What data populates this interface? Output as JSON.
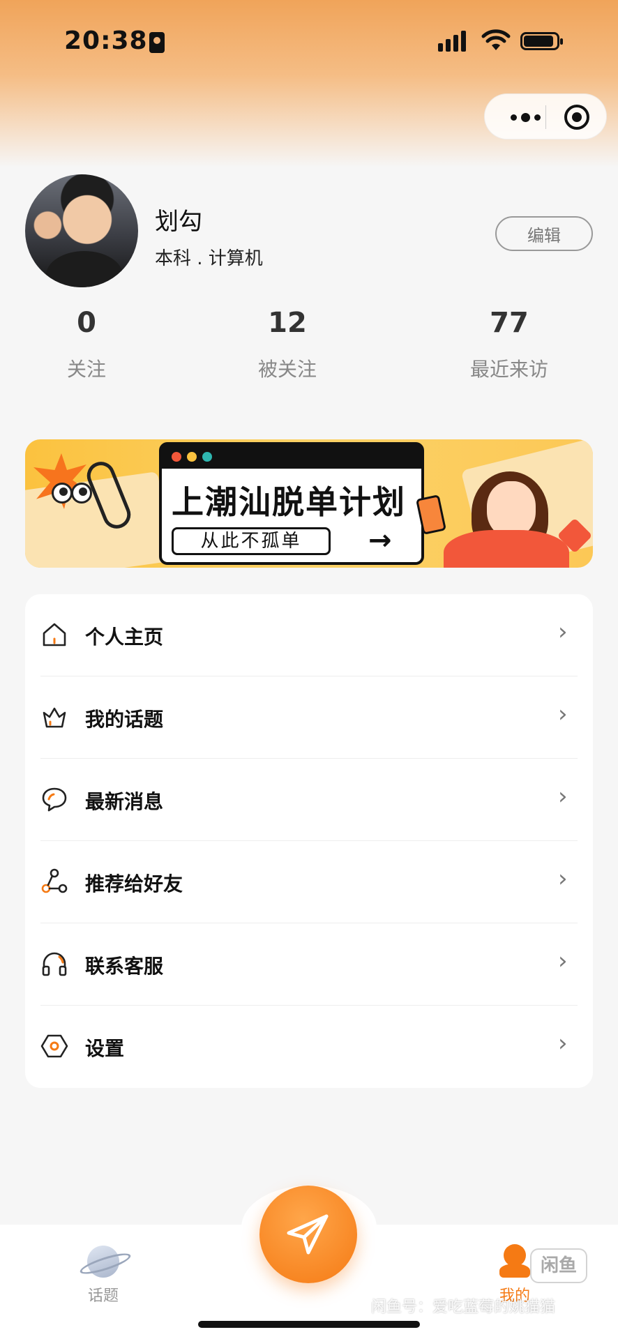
{
  "status_bar": {
    "time": "20:38"
  },
  "profile": {
    "name": "划勾",
    "subtitle": "本科 . 计算机",
    "edit_label": "编辑"
  },
  "stats": [
    {
      "value": "0",
      "label": "关注"
    },
    {
      "value": "12",
      "label": "被关注"
    },
    {
      "value": "77",
      "label": "最近来访"
    }
  ],
  "banner": {
    "title": "上潮汕脱单计划",
    "subtitle": "从此不孤单",
    "arrow": "→"
  },
  "menu": {
    "items": [
      {
        "label": "个人主页",
        "icon": "home-icon"
      },
      {
        "label": "我的话题",
        "icon": "crown-icon"
      },
      {
        "label": "最新消息",
        "icon": "chat-bubble-icon"
      },
      {
        "label": "推荐给好友",
        "icon": "share-icon"
      },
      {
        "label": "联系客服",
        "icon": "headphones-icon"
      },
      {
        "label": "设置",
        "icon": "settings-hexagon-icon"
      }
    ],
    "chevron": "›"
  },
  "tabbar": {
    "tabs": [
      {
        "label": "话题",
        "icon": "planet-icon"
      },
      {
        "label": "我的",
        "icon": "user-icon"
      }
    ]
  },
  "watermark": {
    "text": "闲鱼号：爱吃蓝莓的姚猫猫",
    "badge": "闲鱼"
  },
  "colors": {
    "accent": "#f57a14",
    "banner_bg": "#fbc23f",
    "header": "#f0a45a"
  }
}
